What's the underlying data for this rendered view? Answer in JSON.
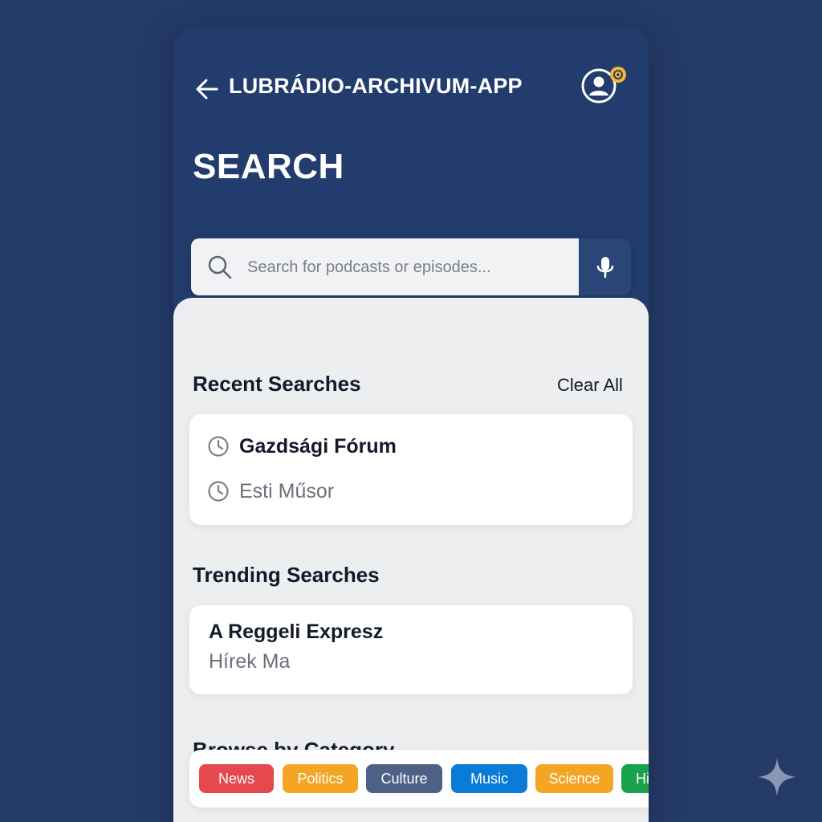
{
  "header": {
    "app_title": "LUBRÁDIO-ARCHIVUM-APP",
    "back_icon": "arrow-left-icon",
    "profile_icon": "user-settings-icon"
  },
  "page": {
    "title": "SEARCH"
  },
  "search": {
    "placeholder": "Search for podcasts or episodes...",
    "value": "",
    "search_icon": "search-icon",
    "mic_icon": "microphone-icon"
  },
  "recent": {
    "title": "Recent Searches",
    "clear_label": "Clear All",
    "items": [
      {
        "label": "Gazdsági Fórum",
        "icon": "clock-icon"
      },
      {
        "label": "Esti Műsor",
        "icon": "clock-icon"
      }
    ]
  },
  "trending": {
    "title": "Trending Searches",
    "items": [
      {
        "label": "A Reggeli Expresz"
      },
      {
        "label": "Hírek Ma"
      }
    ]
  },
  "categories": {
    "title": "Browse by Category",
    "items": [
      {
        "label": "News",
        "color": "#e5484d"
      },
      {
        "label": "Politics",
        "color": "#f5a524"
      },
      {
        "label": "Culture",
        "color": "#4c6185"
      },
      {
        "label": "Music",
        "color": "#0a7bd6"
      },
      {
        "label": "Science",
        "color": "#f5a524"
      },
      {
        "label": "Hi",
        "color": "#18a34a"
      }
    ]
  },
  "colors": {
    "background": "#243a68",
    "header": "#223c6e",
    "content": "#eceef0",
    "accent": "#f5b82e"
  }
}
